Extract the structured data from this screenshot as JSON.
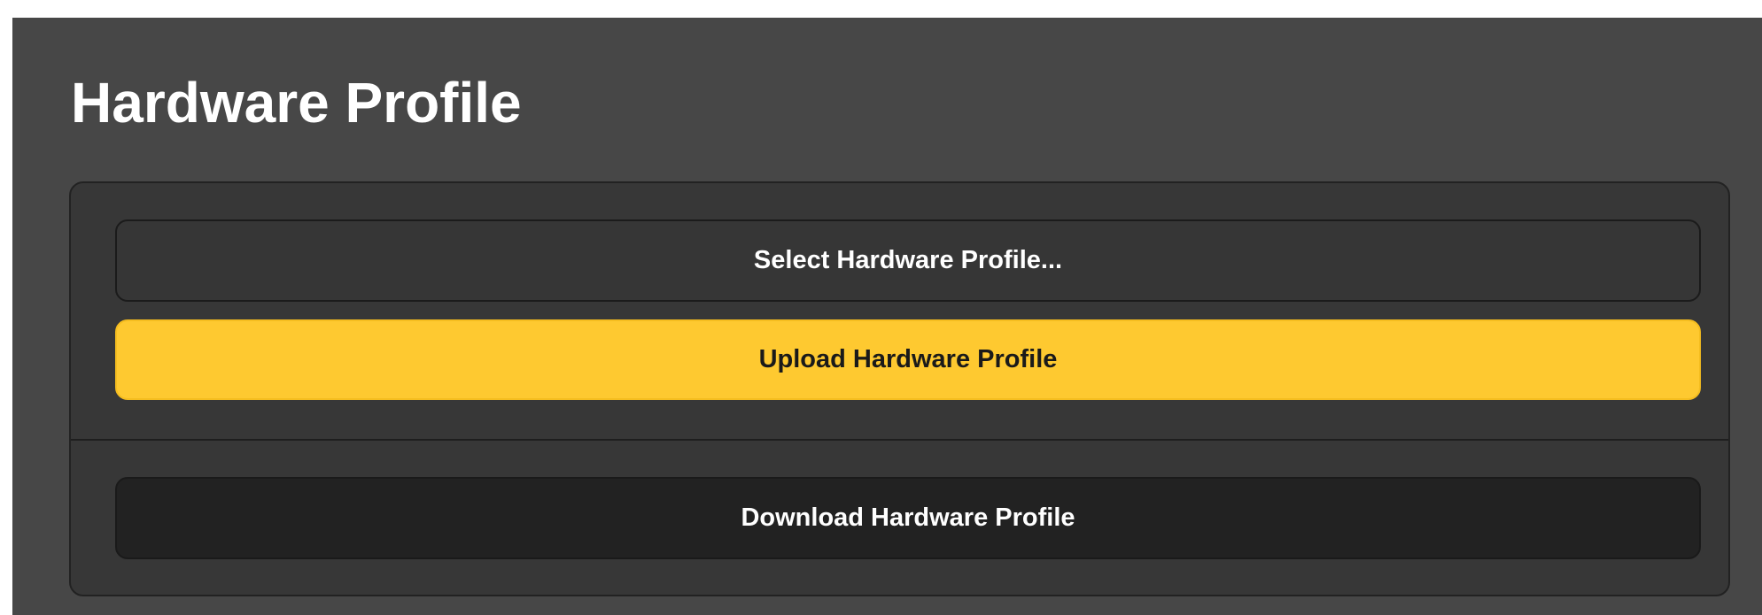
{
  "page": {
    "title": "Hardware Profile"
  },
  "actions": {
    "select_label": "Select Hardware Profile...",
    "upload_label": "Upload Hardware Profile",
    "download_label": "Download Hardware Profile"
  },
  "colors": {
    "background": "#474747",
    "panel": "#373737",
    "accent": "#fec930",
    "download_button": "#222222"
  }
}
